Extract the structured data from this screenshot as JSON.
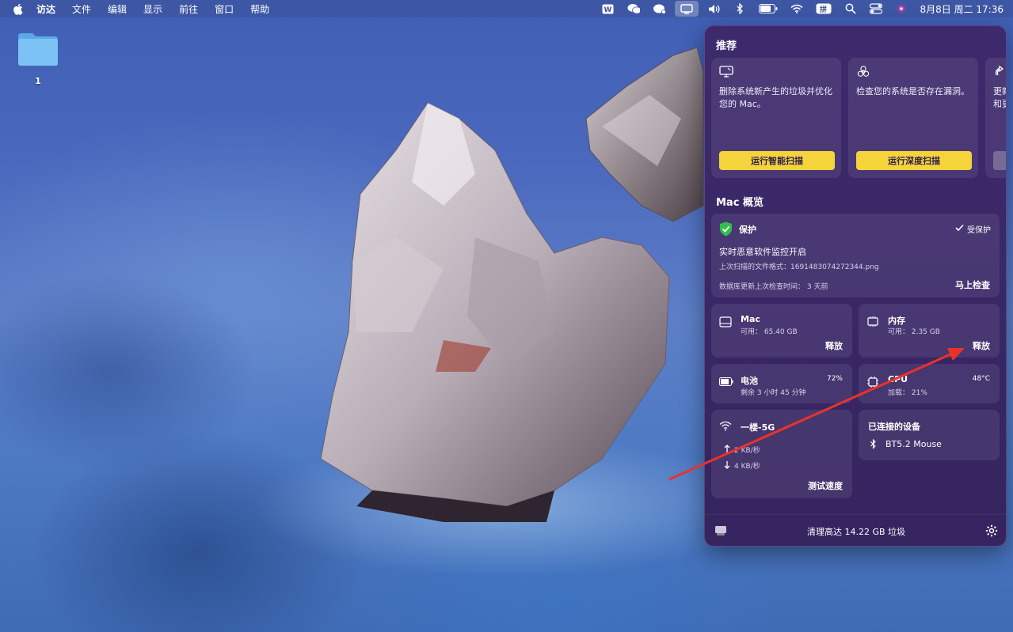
{
  "menubar": {
    "app_name": "访达",
    "items": [
      "文件",
      "编辑",
      "显示",
      "前往",
      "窗口",
      "帮助"
    ],
    "clock": "8月8日 周二  17:36",
    "input_method": "拼"
  },
  "desktop": {
    "folder_label": "1"
  },
  "panel": {
    "recommend_title": "推荐",
    "recommendations": [
      {
        "desc": "删除系统新产生的垃圾并优化您的 Mac。",
        "button": "运行智能扫描",
        "icon": "monitor-clean-icon"
      },
      {
        "desc": "检查您的系统是否存在漏洞。",
        "button": "运行深度扫描",
        "icon": "biohazard-icon"
      },
      {
        "desc": "更新和更",
        "icon": "update-icon"
      }
    ],
    "overview_title": "Mac 概览",
    "protection": {
      "title": "保护",
      "status": "受保护",
      "realtime": "实时恶意软件监控开启",
      "last_scan": "上次扫描的文件格式：1691483074272344.png",
      "db_update": "数据库更新上次检查时间：  3 天前",
      "check_now": "马上检查"
    },
    "mac_disk": {
      "title": "Mac",
      "available": "可用：  65.40 GB",
      "action": "释放"
    },
    "memory": {
      "title": "内存",
      "available": "可用：  2.35 GB",
      "action": "释放"
    },
    "battery": {
      "title": "电池",
      "percent": "72%",
      "remaining": "剩余 3 小时 45 分钟"
    },
    "cpu": {
      "title": "CPU",
      "temp": "48°C",
      "load": "加载：  21%"
    },
    "network": {
      "title": "一楼-5G",
      "upload": "2 KB/秒",
      "download": "4 KB/秒",
      "action": "测试速度"
    },
    "devices": {
      "title": "已连接的设备",
      "items": [
        "BT5.2 Mouse"
      ]
    },
    "footer": {
      "text": "清理高达 14.22 GB 垃圾"
    }
  },
  "colors": {
    "panel_bg": "#3a2868",
    "accent_yellow": "#f5d33b",
    "shield_green": "#2fbf4a",
    "annotation_arrow": "#e8332a"
  }
}
